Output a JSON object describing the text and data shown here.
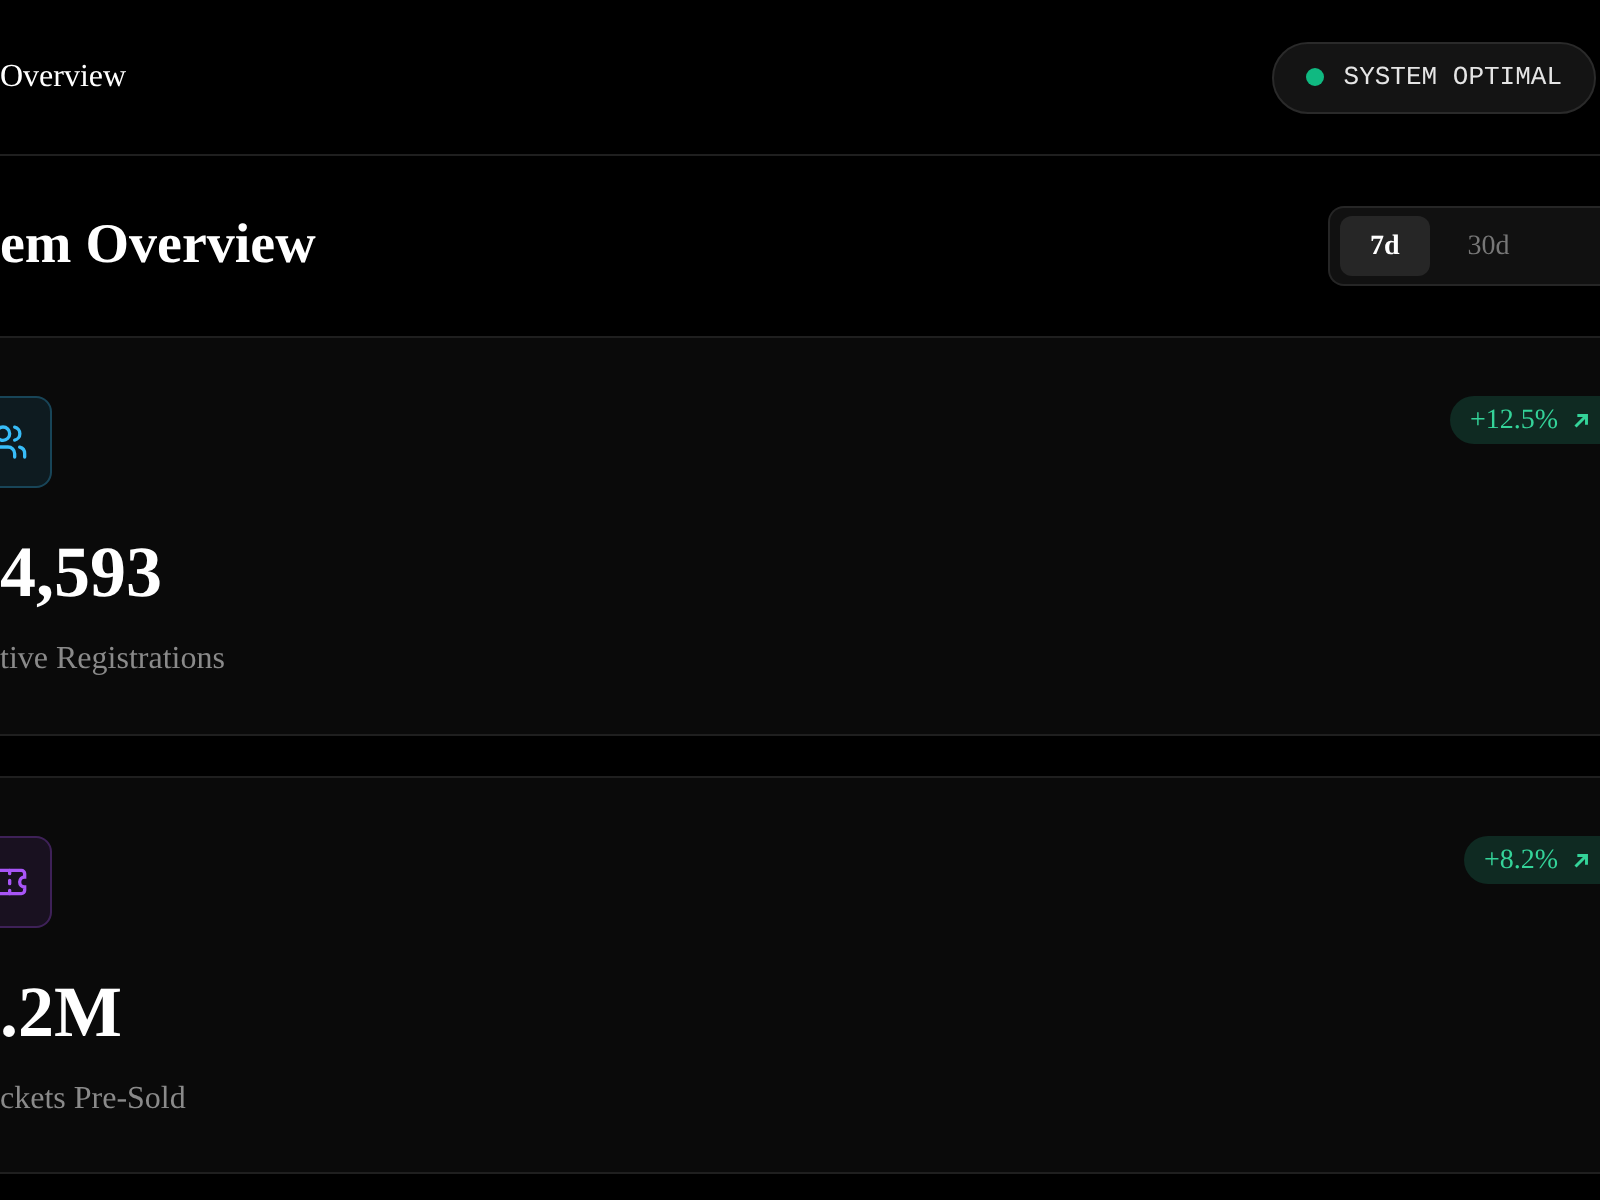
{
  "header": {
    "title": "Overview",
    "status": {
      "label": "SYSTEM OPTIMAL",
      "color": "#10b981"
    }
  },
  "page_title": "em Overview",
  "range_tabs": [
    {
      "label": "7d",
      "selected": true
    },
    {
      "label": "30d",
      "selected": false
    }
  ],
  "stats": [
    {
      "kind": "users",
      "value": "4,593",
      "label": "tive Registrations",
      "change": "+12.5%",
      "color": "#38bdf8"
    },
    {
      "kind": "ticket",
      "value": ".2M",
      "label": "ckets Pre-Sold",
      "change": "+8.2%",
      "color": "#a855f7"
    }
  ]
}
